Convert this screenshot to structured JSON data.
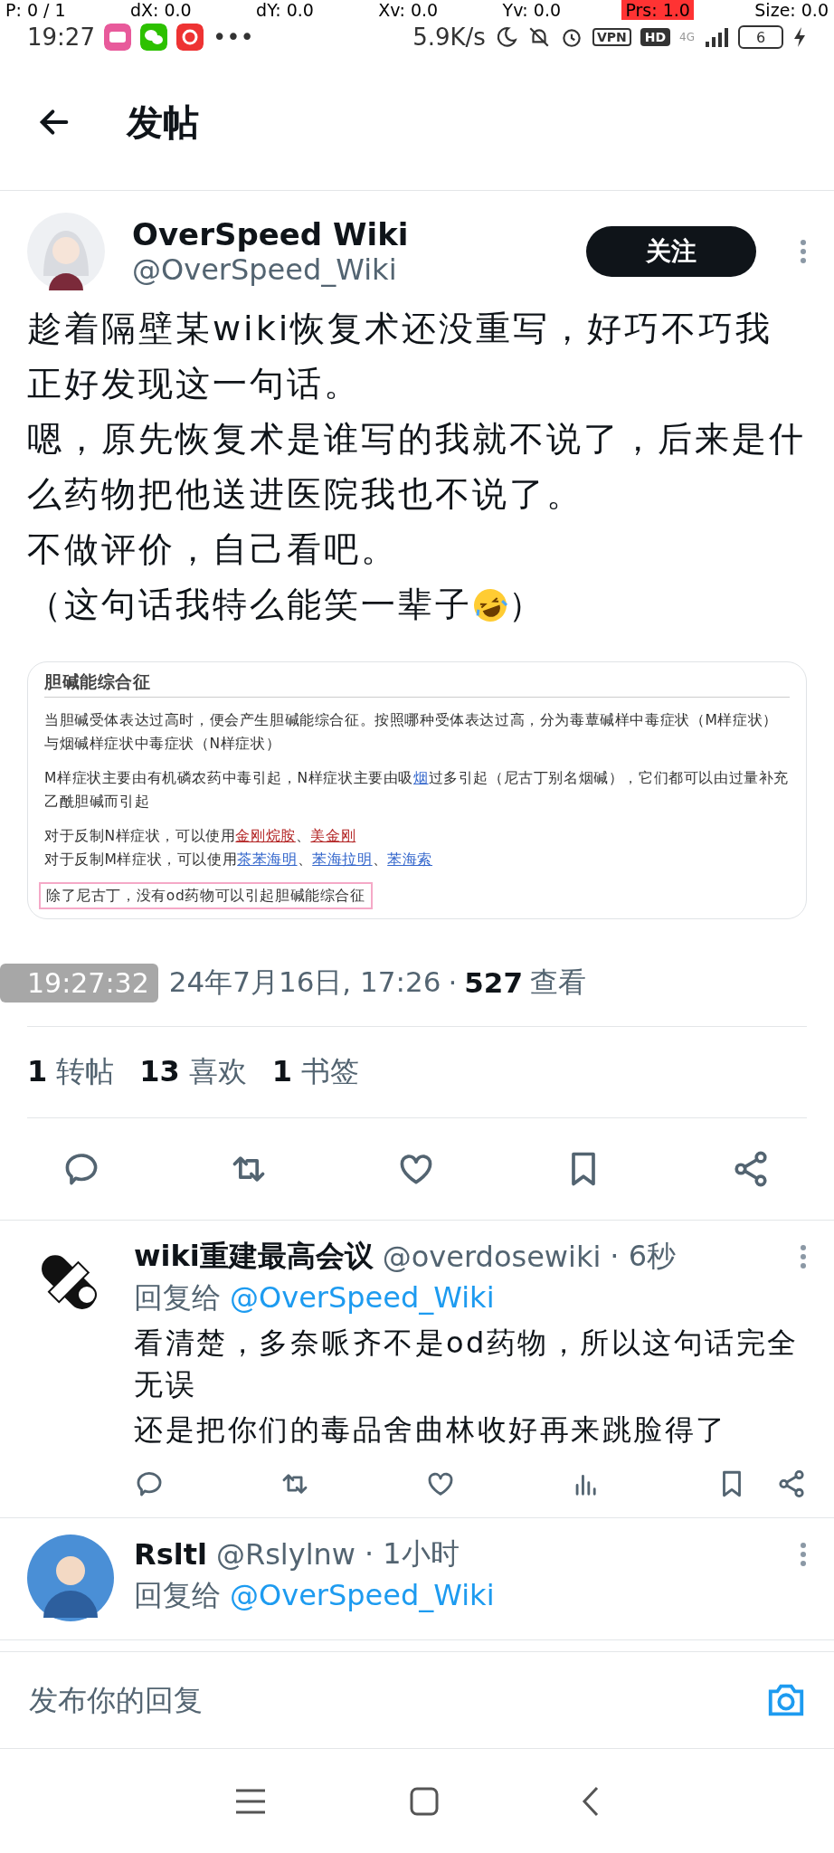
{
  "debug_overlay": [
    {
      "label": "P: 0 / 1",
      "highlighted": false
    },
    {
      "label": "dX: 0.0",
      "highlighted": false
    },
    {
      "label": "dY: 0.0",
      "highlighted": false
    },
    {
      "label": "Xv: 0.0",
      "highlighted": false
    },
    {
      "label": "Yv: 0.0",
      "highlighted": false
    },
    {
      "label": "Prs: 1.0",
      "highlighted": true
    },
    {
      "label": "Size: 0.0",
      "highlighted": false
    }
  ],
  "status_bar": {
    "time": "19:27",
    "more": "•••",
    "speed": "5.9K/s",
    "vpn": "VPN",
    "hd": "HD",
    "network": "4G",
    "battery": "6"
  },
  "header": {
    "title": "发帖"
  },
  "post": {
    "author": "OverSpeed Wiki",
    "handle": "@OverSpeed_Wiki",
    "follow": "关注",
    "paragraphs": [
      {
        "kind": "text",
        "text": "趁着隔壁某wiki恢复术还没重写，好巧不巧我正好发现这一句话。"
      },
      {
        "kind": "text",
        "text": "嗯，原先恢复术是谁写的我就不说了，后来是什么药物把他送进医院我也不说了。"
      },
      {
        "kind": "text",
        "text": "不做评价，自己看吧。"
      },
      {
        "kind": "emoji",
        "before": "（这句话我特么能笑一辈子",
        "after": "）"
      }
    ],
    "quote_image": {
      "blocks": [
        {
          "kind": "heading",
          "parts": [
            {
              "text": "胆碱能综合征"
            }
          ]
        },
        {
          "kind": "paragraph",
          "parts": [
            {
              "text": "当胆碱受体表达过高时，便会产生胆碱能综合征。按照哪种受体表达过高，分为毒蕈碱样中毒症状（M样症状）与烟碱样症状中毒症状（N样症状）"
            }
          ]
        },
        {
          "kind": "paragraph",
          "parts": [
            {
              "text": "M样症状主要由有机磷农药中毒引起，N样症状主要由吸"
            },
            {
              "text": "烟",
              "color": "#3366cc"
            },
            {
              "text": "过多引起（尼古丁别名烟碱），它们都可以由过量补充乙酰胆碱而引起"
            }
          ]
        },
        {
          "kind": "line",
          "parts": [
            {
              "text": "对于反制N样症状，可以使用"
            },
            {
              "text": "金刚烷胺",
              "color": "#b32424"
            },
            {
              "text": "、"
            },
            {
              "text": "美金刚",
              "color": "#b32424"
            }
          ]
        },
        {
          "kind": "line",
          "parts": [
            {
              "text": "对于反制M样症状，可以使用"
            },
            {
              "text": "茶苯海明",
              "color": "#3366cc"
            },
            {
              "text": "、"
            },
            {
              "text": "苯海拉明",
              "color": "#3366cc"
            },
            {
              "text": "、"
            },
            {
              "text": "苯海索",
              "color": "#3366cc"
            }
          ]
        },
        {
          "kind": "highlight",
          "parts": [
            {
              "text": "除了尼古丁，没有od药物可以引起胆碱能综合征"
            }
          ]
        }
      ]
    },
    "date": "24年7月16日, 17:26",
    "dot": "·",
    "views": "527",
    "views_label": "查看",
    "stats": [
      {
        "count": "1",
        "label": "转帖"
      },
      {
        "count": "13",
        "label": "喜欢"
      },
      {
        "count": "1",
        "label": "书签"
      }
    ]
  },
  "timestamp_overlay": "19:27:32",
  "replies": [
    {
      "kind": "pill",
      "name": "wiki重建最高会议",
      "handle": "@overdosewiki",
      "time": "· 6秒",
      "reply_to_label": "回复给",
      "reply_to": "@OverSpeed_Wiki",
      "text": [
        "看清楚，多奈哌齐不是od药物，所以这句话完全无误",
        "还是把你们的毒品舍曲林收好再来跳脸得了"
      ]
    },
    {
      "kind": "figure",
      "name": "Rsltl",
      "handle": "@Rslylnw",
      "time": "· 1小时",
      "reply_to_label": "回复给",
      "reply_to": "@OverSpeed_Wiki"
    }
  ],
  "reply_box": {
    "placeholder": "发布你的回复"
  }
}
